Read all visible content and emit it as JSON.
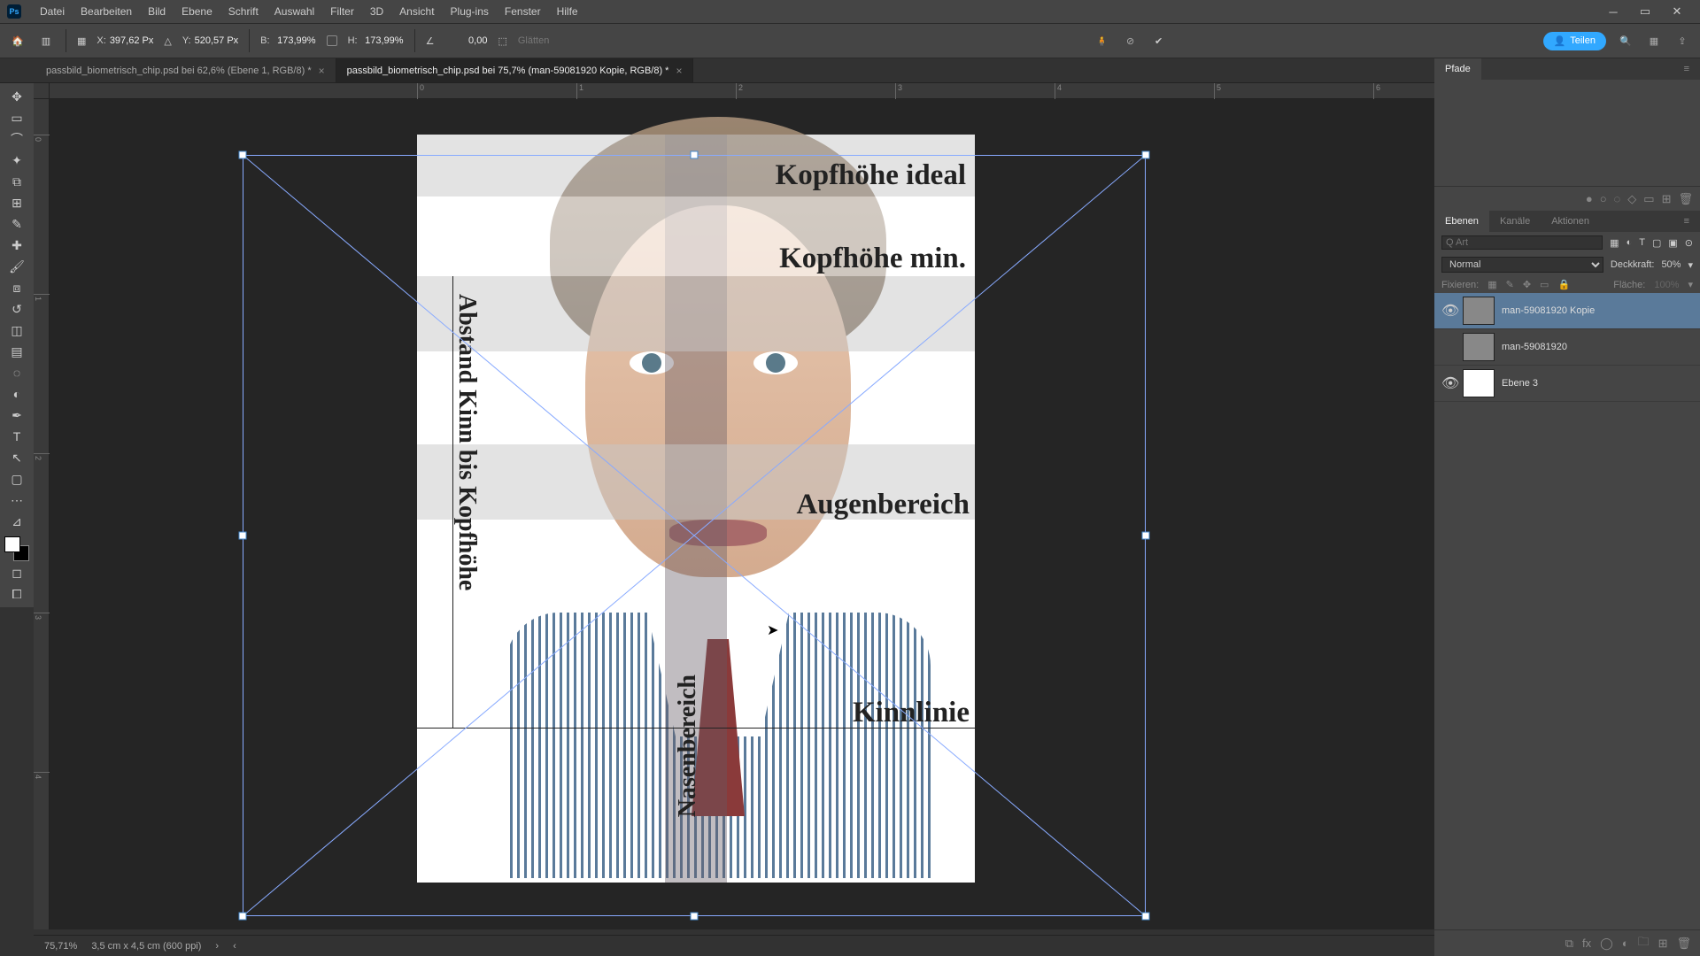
{
  "menu": {
    "items": [
      "Datei",
      "Bearbeiten",
      "Bild",
      "Ebene",
      "Schrift",
      "Auswahl",
      "Filter",
      "3D",
      "Ansicht",
      "Plug-ins",
      "Fenster",
      "Hilfe"
    ]
  },
  "options": {
    "x_label": "X:",
    "x_value": "397,62 Px",
    "y_label": "Y:",
    "y_value": "520,57 Px",
    "w_label": "B:",
    "w_value": "173,99%",
    "h_label": "H:",
    "h_value": "173,99%",
    "angle_value": "0,00",
    "glatten": "Glätten",
    "share": "Teilen"
  },
  "tabs": [
    {
      "title": "passbild_biometrisch_chip.psd bei 62,6% (Ebene 1, RGB/8) *",
      "active": false
    },
    {
      "title": "passbild_biometrisch_chip.psd bei 75,7% (man-59081920 Kopie, RGB/8) *",
      "active": true
    }
  ],
  "template": {
    "kopf_ideal": "Kopfhöhe ideal",
    "kopf_min": "Kopfhöhe min.",
    "augen": "Augenbereich",
    "kinn": "Kinnlinie",
    "nasen": "Nasenbereich",
    "abstand": "Abstand Kinn bis Kopfhöhe"
  },
  "panels": {
    "pfade": "Pfade",
    "ebenen": "Ebenen",
    "kanale": "Kanäle",
    "aktionen": "Aktionen"
  },
  "layers": {
    "filter_placeholder": "Q Art",
    "blend": "Normal",
    "deckkraft_label": "Deckkraft:",
    "deckkraft_value": "50%",
    "fixieren": "Fixieren:",
    "flache_label": "Fläche:",
    "flache_value": "100%",
    "items": [
      {
        "name": "man-59081920 Kopie",
        "visible": true,
        "selected": true
      },
      {
        "name": "man-59081920",
        "visible": false,
        "selected": false
      },
      {
        "name": "Ebene 3",
        "visible": true,
        "selected": false
      }
    ]
  },
  "status": {
    "zoom": "75,71%",
    "doc": "3,5 cm x 4,5 cm (600 ppi)"
  },
  "rulers": {
    "h": [
      "0",
      "1",
      "2",
      "3",
      "4",
      "5",
      "6"
    ],
    "v": [
      "0",
      "1",
      "2",
      "3",
      "4"
    ]
  }
}
